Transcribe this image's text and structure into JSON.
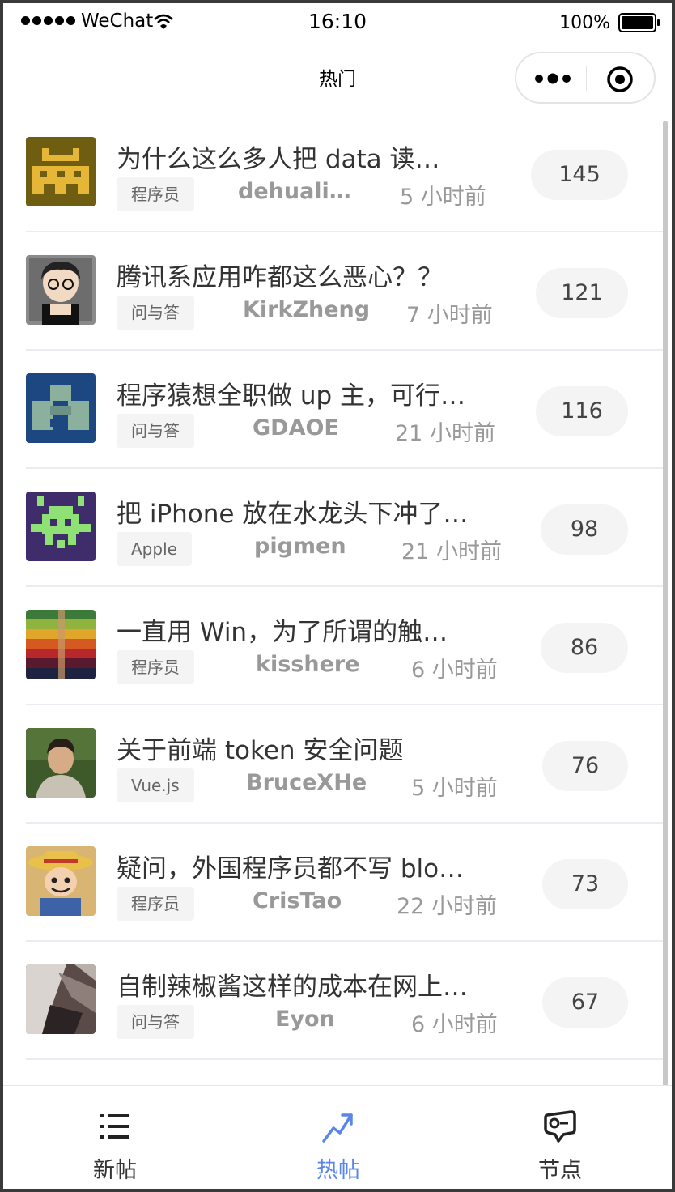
{
  "status_bar": {
    "carrier": "WeChat",
    "time": "16:10",
    "battery": "100%"
  },
  "nav": {
    "title": "热门"
  },
  "posts": [
    {
      "title": "为什么这么多人把 data 读…",
      "node": "程序员",
      "author": "dehuali…",
      "time": "5 小时前",
      "replies": "145",
      "avatar": "yellow-pixel-avatar"
    },
    {
      "title": "腾讯系应用咋都这么恶心？？",
      "node": "问与答",
      "author": "KirkZheng",
      "time": "7 小时前",
      "replies": "121",
      "avatar": "cartoon-glasses-avatar"
    },
    {
      "title": "程序猿想全职做 up 主，可行…",
      "node": "问与答",
      "author": "GDAOE",
      "time": "21 小时前",
      "replies": "116",
      "avatar": "blue-pixel-avatar"
    },
    {
      "title": "把 iPhone 放在水龙头下冲了…",
      "node": "Apple",
      "author": "pigmen",
      "time": "21 小时前",
      "replies": "98",
      "avatar": "space-invader-avatar"
    },
    {
      "title": "一直用 Win，为了所谓的触…",
      "node": "程序员",
      "author": "kisshere",
      "time": "6 小时前",
      "replies": "86",
      "avatar": "stripes-avatar"
    },
    {
      "title": "关于前端 token 安全问题",
      "node": "Vue.js",
      "author": "BruceXHe",
      "time": "5 小时前",
      "replies": "76",
      "avatar": "photo-person-avatar"
    },
    {
      "title": "疑问，外国程序员都不写 blo…",
      "node": "程序员",
      "author": "CrisTao",
      "time": "22 小时前",
      "replies": "73",
      "avatar": "straw-hat-avatar"
    },
    {
      "title": "自制辣椒酱这样的成本在网上…",
      "node": "问与答",
      "author": "Eyon",
      "time": "6 小时前",
      "replies": "67",
      "avatar": "photo-abstract-avatar"
    }
  ],
  "tabbar": {
    "items": [
      {
        "label": "新帖",
        "icon": "list-icon"
      },
      {
        "label": "热帖",
        "icon": "trending-icon",
        "active": true
      },
      {
        "label": "节点",
        "icon": "tag-icon"
      }
    ]
  },
  "colors": {
    "accent": "#5a86e8",
    "meta": "#999999",
    "badge_bg": "#f4f4f4"
  }
}
